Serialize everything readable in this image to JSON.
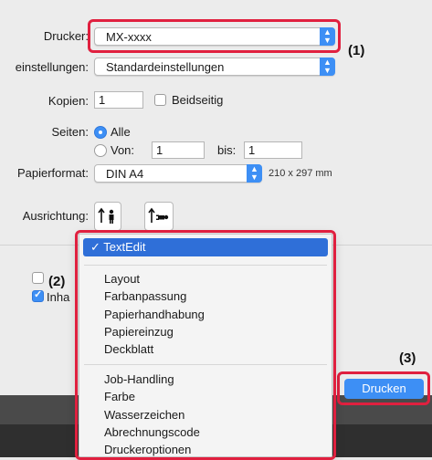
{
  "labels": {
    "drucker": "Drucker:",
    "einstellungen": "einstellungen:",
    "kopien": "Kopien:",
    "seiten": "Seiten:",
    "papierformat": "Papierformat:",
    "ausrichtung": "Ausrichtung:"
  },
  "printer": {
    "value": "MX-xxxx"
  },
  "presets": {
    "value": "Standardeinstellungen"
  },
  "copies": {
    "value": "1",
    "duplex_label": "Beidseitig"
  },
  "pages": {
    "all_label": "Alle",
    "from_label": "Von:",
    "from_value": "1",
    "to_label": "bis:",
    "to_value": "1"
  },
  "paper": {
    "value": "DIN A4",
    "size": "210 x 297 mm"
  },
  "partial_checkbox": {
    "label": "Inha"
  },
  "menu": {
    "selected": "✓ TextEdit",
    "group1": [
      "Layout",
      "Farbanpassung",
      "Papierhandhabung",
      "Papiereinzug",
      "Deckblatt"
    ],
    "group2": [
      "Job-Handling",
      "Farbe",
      "Wasserzeichen",
      "Abrechnungscode",
      "Druckeroptionen"
    ]
  },
  "print_button": {
    "label": "Drucken"
  },
  "callouts": {
    "c1": "(1)",
    "c2": "(2)",
    "c3": "(3)"
  },
  "colors": {
    "accent": "#3d8ff5",
    "highlight": "#e0203f",
    "menu_selected": "#2f6fd8"
  },
  "icons": [
    "chevron-updown-icon",
    "portrait-orientation-icon",
    "landscape-orientation-icon",
    "checkmark-icon"
  ]
}
